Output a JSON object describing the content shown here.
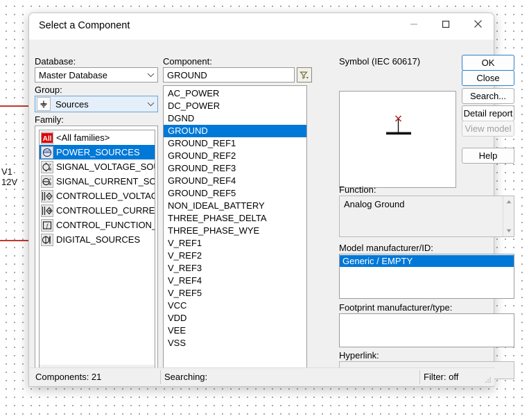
{
  "background": {
    "label_name": "V1",
    "label_value": "12V"
  },
  "dialog": {
    "title": "Select a Component",
    "window_controls": {
      "minimize": "minimize-icon",
      "maximize": "maximize-icon",
      "close": "close-icon"
    }
  },
  "left": {
    "database_label": "Database:",
    "database_value": "Master Database",
    "group_label": "Group:",
    "group_value": "Sources",
    "group_icon": "ground-symbol-icon",
    "family_label": "Family:",
    "families": [
      {
        "label": "<All families>",
        "icon": "all-families-icon",
        "selected": false
      },
      {
        "label": "POWER_SOURCES",
        "icon": "power-sources-icon",
        "selected": true
      },
      {
        "label": "SIGNAL_VOLTAGE_SOURCES",
        "icon": "signal-voltage-icon",
        "selected": false
      },
      {
        "label": "SIGNAL_CURRENT_SOURCES",
        "icon": "signal-current-icon",
        "selected": false
      },
      {
        "label": "CONTROLLED_VOLTAGE_SOURCES",
        "icon": "controlled-voltage-icon",
        "selected": false
      },
      {
        "label": "CONTROLLED_CURRENT_SOURCES",
        "icon": "controlled-current-icon",
        "selected": false
      },
      {
        "label": "CONTROL_FUNCTION_BLOCKS",
        "icon": "control-function-icon",
        "selected": false
      },
      {
        "label": "DIGITAL_SOURCES",
        "icon": "digital-sources-icon",
        "selected": false
      }
    ]
  },
  "middle": {
    "component_label": "Component:",
    "component_value": "GROUND",
    "component_placeholder": "",
    "filter_button_icon": "filter-funnel-icon",
    "components": [
      {
        "label": "AC_POWER",
        "selected": false
      },
      {
        "label": "DC_POWER",
        "selected": false
      },
      {
        "label": "DGND",
        "selected": false
      },
      {
        "label": "GROUND",
        "selected": true
      },
      {
        "label": "GROUND_REF1",
        "selected": false
      },
      {
        "label": "GROUND_REF2",
        "selected": false
      },
      {
        "label": "GROUND_REF3",
        "selected": false
      },
      {
        "label": "GROUND_REF4",
        "selected": false
      },
      {
        "label": "GROUND_REF5",
        "selected": false
      },
      {
        "label": "NON_IDEAL_BATTERY",
        "selected": false
      },
      {
        "label": "THREE_PHASE_DELTA",
        "selected": false
      },
      {
        "label": "THREE_PHASE_WYE",
        "selected": false
      },
      {
        "label": "V_REF1",
        "selected": false
      },
      {
        "label": "V_REF2",
        "selected": false
      },
      {
        "label": "V_REF3",
        "selected": false
      },
      {
        "label": "V_REF4",
        "selected": false
      },
      {
        "label": "V_REF5",
        "selected": false
      },
      {
        "label": "VCC",
        "selected": false
      },
      {
        "label": "VDD",
        "selected": false
      },
      {
        "label": "VEE",
        "selected": false
      },
      {
        "label": "VSS",
        "selected": false
      }
    ]
  },
  "right": {
    "symbol_label": "Symbol (IEC 60617)",
    "symbol_icon": "ground-symbol-preview",
    "function_label": "Function:",
    "function_value": "Analog Ground",
    "model_label": "Model manufacturer/ID:",
    "model_value": "Generic / EMPTY",
    "footprint_label": "Footprint manufacturer/type:",
    "footprint_value": "",
    "hyperlink_label": "Hyperlink:",
    "hyperlink_value": ""
  },
  "buttons": [
    {
      "label": "OK",
      "state": "default"
    },
    {
      "label": "Close",
      "state": "default"
    },
    {
      "label": "Search...",
      "state": "normal"
    },
    {
      "label": "Detail report",
      "state": "normal"
    },
    {
      "label": "View model",
      "state": "disabled"
    },
    {
      "label": "Help",
      "state": "normal"
    }
  ],
  "statusbar": {
    "components": "Components: 21",
    "searching": "Searching:",
    "filter": "Filter: off"
  },
  "colors": {
    "selection": "#0078d7",
    "accent_border": "#2a7fc9",
    "wire": "#c0392b",
    "dialog_bg": "#f0f0f0"
  }
}
